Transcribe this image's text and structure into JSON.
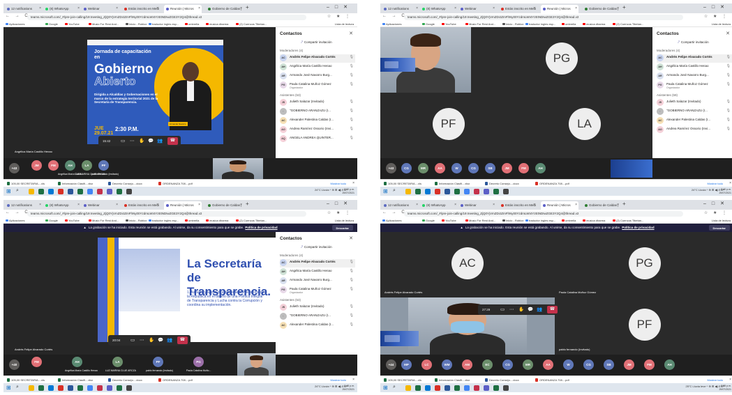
{
  "chrome": {
    "tabs": [
      {
        "label": "12 notifications",
        "icon": "#5c6bc0"
      },
      {
        "label": "(8) WhatsApp",
        "icon": "#25d366"
      },
      {
        "label": "Webinar",
        "icon": "#5b5fc7"
      },
      {
        "label": "Estás inscrito en Medi",
        "icon": "#d93025"
      },
      {
        "label": "Reunión | Micros",
        "icon": "#5b5fc7"
      },
      {
        "label": "Gobierno de Caldas |",
        "icon": "#2e7d32"
      }
    ],
    "new_tab": "+",
    "window_controls": "–□✕",
    "url": "teams.microsoft.com/_#/pre-join-calling/19:meeting_ZjQ0YjVmZDctZmFhNy00YzdmLWI4YzEtNDIwZGE3Y2Q4@thread.v2",
    "nav": "← → C",
    "addr_icons": "☆ ★ ⋮",
    "bookmarks": [
      {
        "label": "Aplicaciones",
        "color": "#4285f4"
      },
      {
        "label": "Google",
        "color": "#34a853"
      },
      {
        "label": "YouTube",
        "color": "#ff0000"
      },
      {
        "label": "Music For Rest And...",
        "color": "#ff0000"
      },
      {
        "label": "Inicio - Roblox",
        "color": "#555555"
      },
      {
        "label": "traductor ingles esp...",
        "color": "#4285f4"
      },
      {
        "label": "umbrella",
        "color": "#ff0000"
      },
      {
        "label": "musica dharma",
        "color": "#ff0000"
      },
      {
        "label": "(2) Cuencos Tibetan...",
        "color": "#ff0000"
      }
    ],
    "reading_list": "Lista de lectura"
  },
  "recording": {
    "message": "La grabación se ha iniciado. Esta reunión se está grabando. Al unirse, da su consentimiento para que se grabe.",
    "link": "Política de privacidad",
    "dismiss": "Descartar"
  },
  "panel": {
    "title": "Contactos",
    "close": "✕",
    "share": "Compartir invitación",
    "moderators_label": "Moderadores (4)",
    "attendees_label_1": "Asistentes (53)",
    "attendees_label_2": "Asistentes (59)",
    "moderators": [
      {
        "initials": "AC",
        "name": "Andrés Felipe Alvarado Cortés",
        "color": "#c7d3ef"
      },
      {
        "initials": "AH",
        "name": "Angélica María Castillo Henao",
        "color": "#cfe2d6"
      },
      {
        "initials": "AR",
        "name": "Armando José Navarro Burg...",
        "color": "#d9e0ef"
      },
      {
        "initials": "PG",
        "name": "Paula Catalina Muñoz Gómez",
        "sub": "Organizador",
        "color": "#e7d8e8"
      }
    ],
    "attendees": [
      {
        "initials": "JS",
        "name": "Julieth Salazar (Invitado)",
        "color": "#f4d0d8"
      },
      {
        "initials": "·",
        "name": "\"GOBIERNO ARANZAZU (I...",
        "color": "#bdbdbd"
      },
      {
        "initials": "AC",
        "name": "Alexander Palestina Caldas (I...",
        "color": "#f6e0b5"
      },
      {
        "initials": "AO",
        "name": "Andrea Ramírez Ossorio (Invi...",
        "color": "#f4d0d8"
      },
      {
        "initials": "AQ",
        "name": "ANGELA ANDREA QUINTER...",
        "color": "#f4d0d8"
      }
    ]
  },
  "meeting": {
    "timer_1": "15:42",
    "timer_3": "20:04",
    "timer_4": "27:29",
    "speaker_1": "Angélica María Castillo Henao",
    "speaker_3": "Andrés Felipe Alvarado Cortés",
    "overflow_1": "+43",
    "overflow_2": "+43",
    "overflow_3": "+40",
    "overflow_4": "+44",
    "tile_ac": "AC",
    "tile_pg": "PG",
    "tile_pf": "PF",
    "tile_la": "LA",
    "tile_ac_name": "Andrés Felipe Alvarado Cortés",
    "tile_pg_name": "Paula Catalina Muñoz Gómez",
    "tile_pf_name": "pablo fernando (Invitado)"
  },
  "strip_1": [
    {
      "initials": "JM",
      "color": "#e17076"
    },
    {
      "initials": "FM",
      "color": "#e17076"
    },
    {
      "initials": "AH",
      "color": "#5a8a72",
      "name": "Angélica María Castil..."
    },
    {
      "initials": "LA",
      "color": "#6b8e6b",
      "name": "LUZ MARINA CLUE ARCZA"
    },
    {
      "initials": "PF",
      "color": "#5f77b8",
      "name": "pablo fernando (Invitado)"
    }
  ],
  "strip_2": [
    {
      "initials": "CG",
      "color": "#5f77b8"
    },
    {
      "initials": "MR",
      "color": "#6b8e6b"
    },
    {
      "initials": "AA",
      "color": "#e17076"
    },
    {
      "initials": "W",
      "color": "#5f77b8"
    },
    {
      "initials": "CG",
      "color": "#5f77b8"
    },
    {
      "initials": "SB",
      "color": "#5f77b8"
    },
    {
      "initials": "JM",
      "color": "#e17076"
    },
    {
      "initials": "FM",
      "color": "#e17076"
    },
    {
      "initials": "AH",
      "color": "#5a8a72"
    }
  ],
  "strip_3": [
    {
      "initials": "FM",
      "color": "#e17076"
    },
    {
      "initials": "AH",
      "color": "#5a8a72",
      "name": "Angélica María Castillo Henao"
    },
    {
      "initials": "LA",
      "color": "#6b8e6b",
      "name": "LUZ MARINA CLUE ARCZA"
    },
    {
      "initials": "PF",
      "color": "#5f77b8",
      "name": "pablo fernando (Invitado)"
    },
    {
      "initials": "PG",
      "color": "#9b6ea8",
      "name": "Paula Catalina Muño..."
    }
  ],
  "strip_4": [
    {
      "initials": "MP",
      "color": "#5f77b8"
    },
    {
      "initials": "LC",
      "color": "#e17076"
    },
    {
      "initials": "WM",
      "color": "#5f77b8"
    },
    {
      "initials": "AM",
      "color": "#e17076"
    },
    {
      "initials": "EC",
      "color": "#6b8e6b"
    },
    {
      "initials": "CG",
      "color": "#5f77b8"
    },
    {
      "initials": "MR",
      "color": "#6b8e6b"
    },
    {
      "initials": "AA",
      "color": "#e17076"
    },
    {
      "initials": "W",
      "color": "#5f77b8"
    },
    {
      "initials": "CG",
      "color": "#5f77b8"
    },
    {
      "initials": "SB",
      "color": "#5f77b8"
    },
    {
      "initials": "JM",
      "color": "#e17076"
    },
    {
      "initials": "FM",
      "color": "#e17076"
    },
    {
      "initials": "AH",
      "color": "#5a8a72"
    }
  ],
  "slide_1": {
    "subtitle": "Jornada de capacitación en",
    "title_1": "Gobierno",
    "title_2": "Abierto",
    "body": "Dirigida a Alcaldías y Gobernaciones en el marco de la estrategia territorial 2021 de la Secretaría de Transparencia.",
    "date": "JUE 29.07.21",
    "time": "2:30 P.M.",
    "tag": "Armando Navarro"
  },
  "slide_3": {
    "title": "La Secretaría de Transparencia.",
    "body": "1. Asesora y apoya directamente al Presidente de la República en el diseño de una Política Integral de Transparencia y Lucha contra la Corrupción y coordina su implementación."
  },
  "downloads": [
    {
      "label": "105,00 SECRETARIA....xls",
      "color": "#1d6f42"
    },
    {
      "label": "Información Clasifi....xlsx",
      "color": "#1d6f42"
    },
    {
      "label": "Decreto Consejo....docx",
      "color": "#2b579a"
    },
    {
      "label": "ORDENANZA 708....pdf",
      "color": "#d93025"
    }
  ],
  "downloads_show_all": "Mostrar todo",
  "taskbar": {
    "tray_1": "24°C Lluvia  ^ ⊕ ⊞ ◀) ESP",
    "tray_4": "25°C Lluvia leve  ^ ⊕ ⊞ ◀) ESP",
    "clock_1": "2:32 p.m.",
    "clock_2": "2:40 p.m.",
    "clock_3": "2:48 p.m.",
    "clock_4": "2:55 p.m.",
    "date": "29/07/2021"
  }
}
